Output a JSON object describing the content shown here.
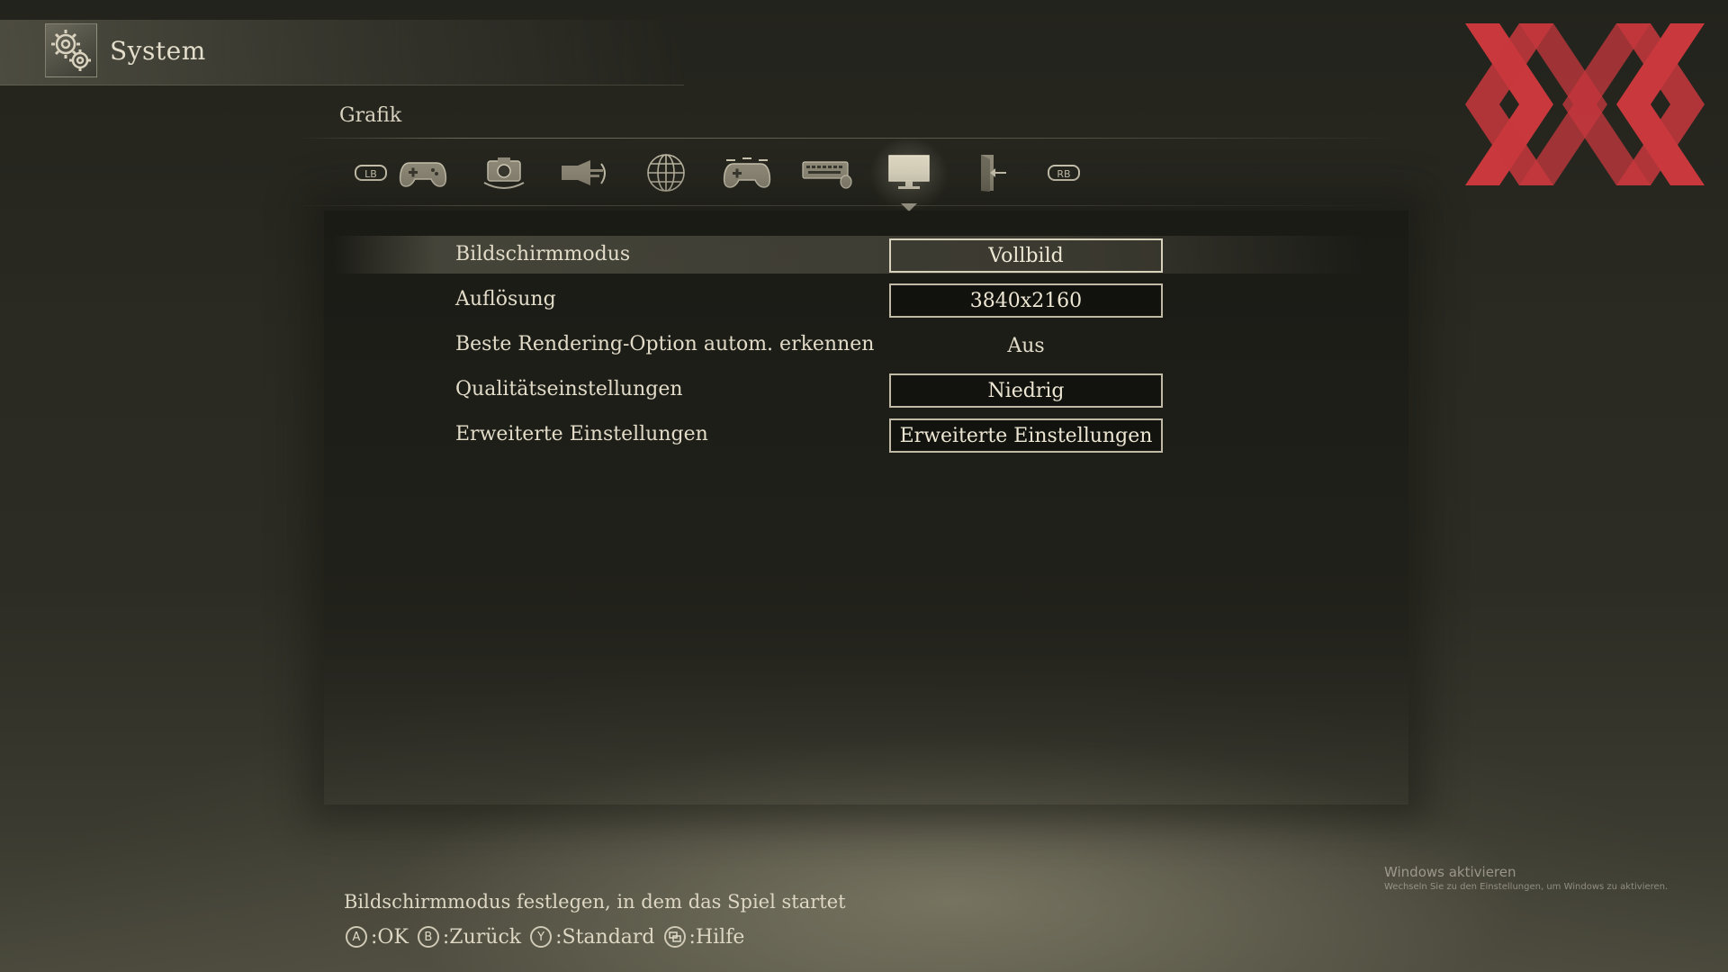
{
  "header": {
    "title": "System",
    "icon": "gears-icon"
  },
  "logo": {
    "name": "xx-logo",
    "color": "#d63a40"
  },
  "section": {
    "title": "Grafik"
  },
  "tabs": [
    {
      "id": "lb",
      "icon": "lb-bumper-icon",
      "glyph": "LB"
    },
    {
      "id": "controller",
      "icon": "gamepad-icon"
    },
    {
      "id": "camera",
      "icon": "camera-icon"
    },
    {
      "id": "sound",
      "icon": "speaker-icon"
    },
    {
      "id": "network",
      "icon": "globe-icon"
    },
    {
      "id": "controls",
      "icon": "controller-layout-icon"
    },
    {
      "id": "keyboard",
      "icon": "keyboard-mouse-icon"
    },
    {
      "id": "display",
      "icon": "monitor-icon",
      "active": true
    },
    {
      "id": "quit",
      "icon": "exit-door-icon"
    },
    {
      "id": "rb",
      "icon": "rb-bumper-icon",
      "glyph": "RB"
    }
  ],
  "settings": [
    {
      "label": "Bildschirmmodus",
      "value": "Vollbild",
      "boxed": true,
      "selected": true
    },
    {
      "label": "Auflösung",
      "value": "3840x2160",
      "boxed": true,
      "selected": false
    },
    {
      "label": "Beste Rendering-Option autom. erkennen",
      "value": "Aus",
      "boxed": false,
      "selected": false
    },
    {
      "label": "Qualitätseinstellungen",
      "value": "Niedrig",
      "boxed": true,
      "selected": false
    },
    {
      "label": "Erweiterte Einstellungen",
      "value": "Erweiterte Einstellungen",
      "boxed": true,
      "selected": false
    }
  ],
  "help": {
    "description": "Bildschirmmodus festlegen, in dem das Spiel startet"
  },
  "controls": [
    {
      "button": "A",
      "label": ":OK"
    },
    {
      "button": "B",
      "label": ":Zurück"
    },
    {
      "button": "Y",
      "label": ":Standard"
    },
    {
      "button": "view",
      "label": ":Hilfe"
    }
  ],
  "windows_activation": {
    "title": "Windows aktivieren",
    "subtitle": "Wechseln Sie zu den Einstellungen, um Windows zu aktivieren."
  }
}
